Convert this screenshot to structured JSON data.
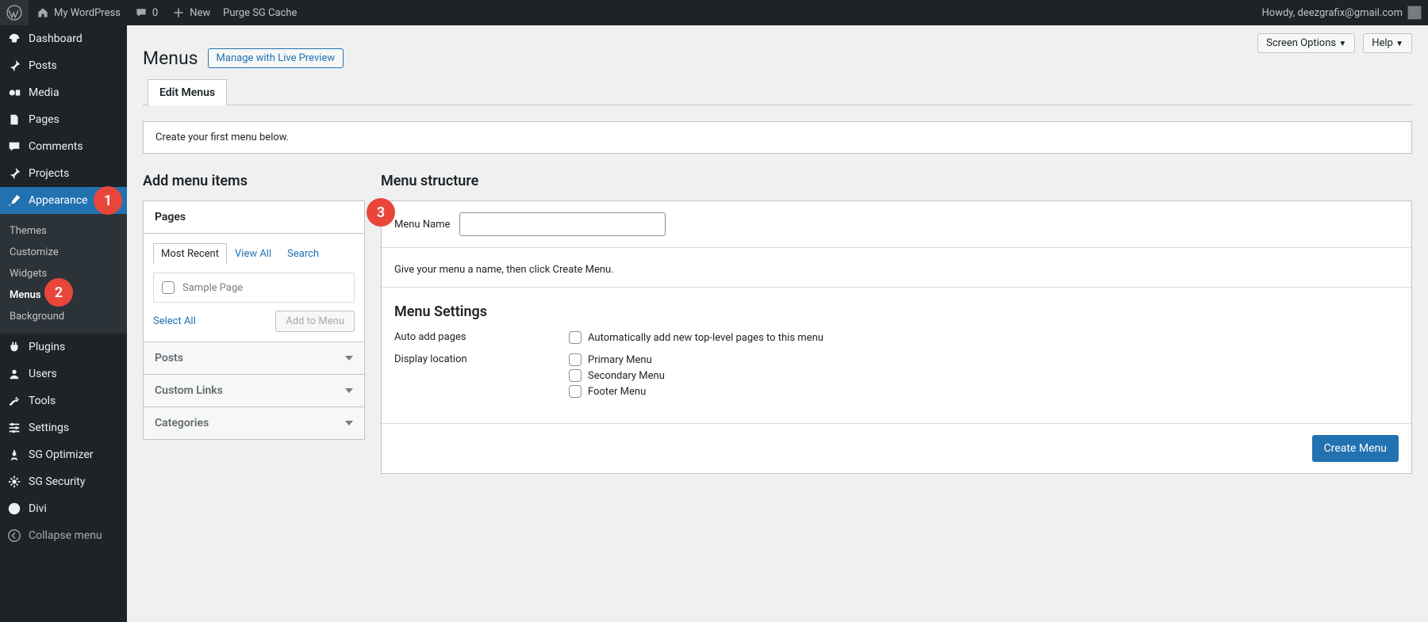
{
  "adminbar": {
    "site": "My WordPress",
    "comments": "0",
    "new": "New",
    "purge": "Purge SG Cache",
    "howdy": "Howdy, deezgrafix@gmail.com"
  },
  "sidebar": {
    "items": [
      {
        "label": "Dashboard"
      },
      {
        "label": "Posts"
      },
      {
        "label": "Media"
      },
      {
        "label": "Pages"
      },
      {
        "label": "Comments"
      },
      {
        "label": "Projects"
      },
      {
        "label": "Appearance"
      },
      {
        "label": "Plugins"
      },
      {
        "label": "Users"
      },
      {
        "label": "Tools"
      },
      {
        "label": "Settings"
      },
      {
        "label": "SG Optimizer"
      },
      {
        "label": "SG Security"
      },
      {
        "label": "Divi"
      }
    ],
    "submenu": [
      "Themes",
      "Customize",
      "Widgets",
      "Menus",
      "Background"
    ],
    "collapse": "Collapse menu"
  },
  "topopts": {
    "screen": "Screen Options",
    "help": "Help"
  },
  "heading": {
    "title": "Menus",
    "live": "Manage with Live Preview"
  },
  "tab": "Edit Menus",
  "notice": "Create your first menu below.",
  "left": {
    "title": "Add menu items",
    "pages": "Pages",
    "tabs": {
      "recent": "Most Recent",
      "viewall": "View All",
      "search": "Search"
    },
    "sample": "Sample Page",
    "selectall": "Select All",
    "addto": "Add to Menu",
    "posts": "Posts",
    "custom": "Custom Links",
    "cats": "Categories"
  },
  "right": {
    "title": "Menu structure",
    "menuname_lbl": "Menu Name",
    "hint": "Give your menu a name, then click Create Menu.",
    "settings": "Menu Settings",
    "auto_lbl": "Auto add pages",
    "auto_opt": "Automatically add new top-level pages to this menu",
    "disp_lbl": "Display location",
    "loc1": "Primary Menu",
    "loc2": "Secondary Menu",
    "loc3": "Footer Menu",
    "create": "Create Menu"
  },
  "bubbles": {
    "one": "1",
    "two": "2",
    "three": "3"
  }
}
